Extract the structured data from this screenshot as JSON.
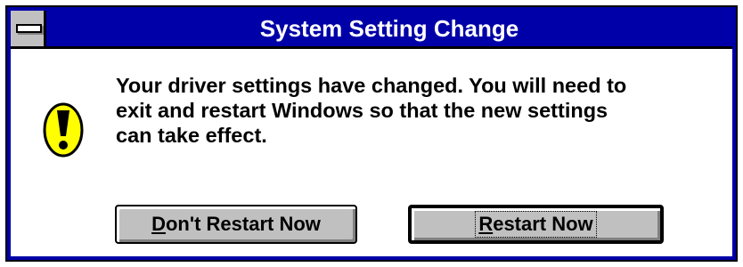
{
  "window": {
    "title": "System Setting Change",
    "system_menu_icon": "minus-bar-icon"
  },
  "dialog": {
    "icon": "exclamation-icon",
    "icon_color": "#ffff00",
    "message": "Your driver settings have changed. You will need to\nexit and restart Windows so that the new settings\ncan take effect."
  },
  "buttons": {
    "dont_restart": {
      "mnemonic": "D",
      "label_rest": "on't Restart Now"
    },
    "restart": {
      "mnemonic": "R",
      "label_rest": "estart Now"
    }
  },
  "colors": {
    "titlebar": "#0000a8",
    "button_face": "#c0c0c0"
  }
}
